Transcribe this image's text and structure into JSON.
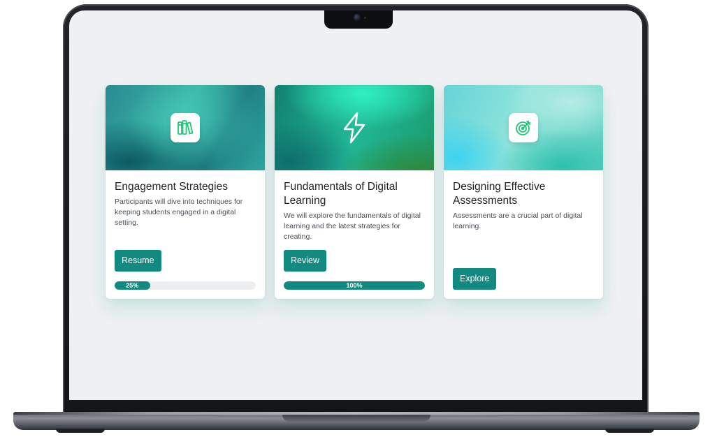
{
  "colors": {
    "accent": "#138a80",
    "screen_bg": "#eff0f2",
    "card_bg": "#ffffff",
    "progress_track": "#eceef0"
  },
  "courses": [
    {
      "icon": "books-icon",
      "title": "Engagement Strategies",
      "description": "Participants will dive into techniques for keeping students engaged in a digital setting.",
      "button_label": "Resume",
      "progress": 0.25,
      "progress_label": "25%"
    },
    {
      "icon": "lightning-icon",
      "title": "Fundamentals of Digital Learning",
      "description": "We will explore the fundamentals of digital learning and the latest strategies for creating.",
      "button_label": "Review",
      "progress": 1.0,
      "progress_label": "100%"
    },
    {
      "icon": "target-icon",
      "title": "Designing Effective Assessments",
      "description": "Assessments are a crucial part of digital learning.",
      "button_label": "Explore"
    }
  ]
}
